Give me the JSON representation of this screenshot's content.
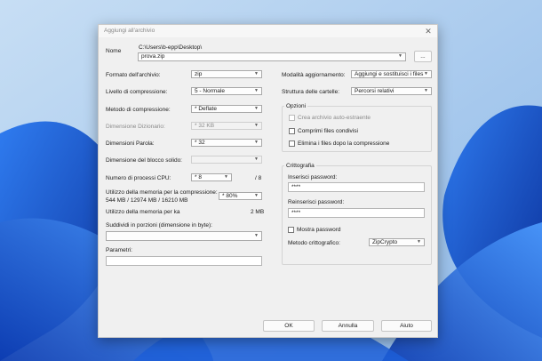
{
  "dialog": {
    "title": "Aggiungi all'archivio",
    "close_icon": "close-icon"
  },
  "name": {
    "label": "Nome",
    "path": "C:\\Users\\b-epp\\Desktop\\",
    "value": "prova.zip",
    "browse_label": "..."
  },
  "left": {
    "format_label": "Formato dell'archivio:",
    "format_value": "zip",
    "level_label": "Livello di compressione:",
    "level_value": "5 - Normale",
    "method_label": "Metodo di compressione:",
    "method_value": "* Deflate",
    "dict_label": "Dimensione Dizionario:",
    "dict_value": "* 32 KB",
    "word_label": "Dimensioni Parola:",
    "word_value": "* 32",
    "solid_label": "Dimensione del blocco solido:",
    "solid_value": "",
    "threads_label": "Numero di processi CPU:",
    "threads_value": "* 8",
    "threads_max": "/ 8",
    "mem_comp_label": "Utilizzo della memoria per la compressione:",
    "mem_comp_detail": "544 MB / 12974 MB / 16210 MB",
    "mem_comp_value": "* 80%",
    "mem_decomp_label": "Utilizzo della memoria per ka",
    "mem_decomp_value": "2 MB",
    "split_label": "Suddividi in porzioni (dimensione in byte):",
    "split_value": "",
    "params_label": "Parametri:",
    "params_value": ""
  },
  "right": {
    "update_label": "Modalità aggiornamento:",
    "update_value": "Aggiungi e sostituisci i files",
    "paths_label": "Struttura delle cartelle:",
    "paths_value": "Percorsi relativi",
    "options_title": "Opzioni",
    "sfx_label": "Crea archivio auto-estraente",
    "shared_label": "Comprimi files condivisi",
    "delete_label": "Elimina i files dopo la compressione",
    "crypto_title": "Crittografia",
    "pwd_label": "Inserisci password:",
    "pwd_value": "****",
    "pwd2_label": "Reinserisci password:",
    "pwd2_value": "****",
    "show_pwd_label": "Mostra password",
    "enc_method_label": "Metodo crittografico:",
    "enc_method_value": "ZipCrypto"
  },
  "buttons": {
    "ok": "OK",
    "cancel": "Annulla",
    "help": "Aiuto"
  },
  "colors": {
    "wallpaper_light": "#9fc6ec",
    "wallpaper_dark": "#0c3ea8",
    "dialog_bg": "#f0f0f0"
  }
}
